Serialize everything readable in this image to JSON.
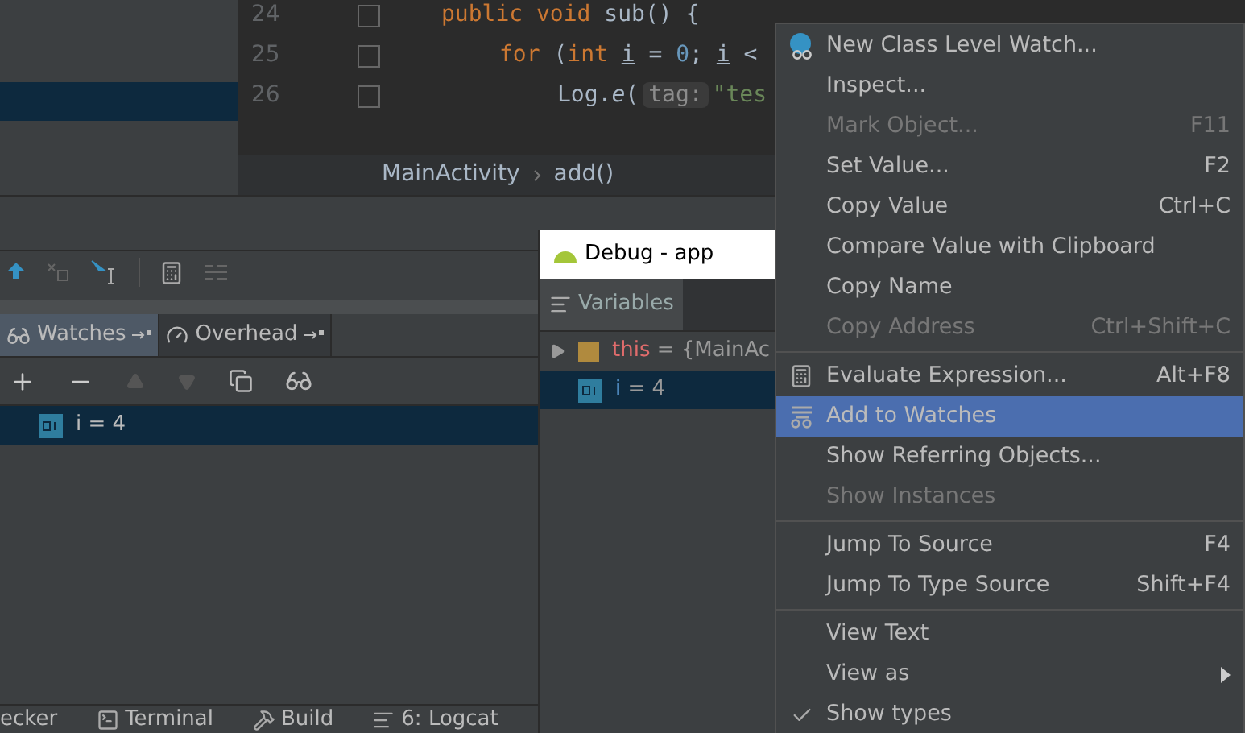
{
  "editor": {
    "lines": [
      {
        "number": "24",
        "tokens": [
          {
            "kind": "keyword",
            "text": "public void "
          },
          {
            "kind": "plain",
            "text": "sub() {"
          }
        ]
      },
      {
        "number": "25",
        "tokens": [
          {
            "kind": "keyword",
            "text": "for "
          },
          {
            "kind": "plain",
            "text": "("
          },
          {
            "kind": "keyword",
            "text": "int "
          },
          {
            "kind": "var",
            "text": "i"
          },
          {
            "kind": "plain",
            "text": " = "
          },
          {
            "kind": "number",
            "text": "0"
          },
          {
            "kind": "plain",
            "text": "; "
          },
          {
            "kind": "var",
            "text": "i"
          },
          {
            "kind": "plain",
            "text": " <"
          }
        ]
      },
      {
        "number": "26",
        "tokens": [
          {
            "kind": "plain",
            "text": "Log."
          },
          {
            "kind": "italic",
            "text": "e"
          },
          {
            "kind": "plain",
            "text": "("
          },
          {
            "kind": "hint",
            "text": "tag:"
          },
          {
            "kind": "string",
            "text": "\"tes"
          }
        ]
      }
    ],
    "breadcrumb": [
      "MainActivity",
      "add()"
    ]
  },
  "debug_tabs": [
    {
      "label": "Watches",
      "selected": true
    },
    {
      "label": "Overhead",
      "selected": false
    }
  ],
  "watches": [
    {
      "text": "i = 4",
      "selected": true
    }
  ],
  "bottom_tabs": [
    {
      "label": "ecker",
      "kind": "plain"
    },
    {
      "label": "Terminal",
      "kind": "terminal"
    },
    {
      "label": "Build",
      "kind": "build"
    },
    {
      "label": "6: Logcat",
      "kind": "logcat"
    }
  ],
  "floating_window": {
    "title": "Debug - app",
    "tab": "Variables",
    "variables": [
      {
        "name": "this",
        "value": " = {MainAc",
        "kind": "object",
        "selected": false
      },
      {
        "name": "i",
        "value": " = 4",
        "kind": "primitive",
        "selected": true
      }
    ]
  },
  "context_menu": [
    {
      "kind": "item",
      "label": "New Class Level Watch...",
      "disabled": false,
      "selected": false
    },
    {
      "kind": "item",
      "label": "Inspect...",
      "disabled": false,
      "selected": false
    },
    {
      "kind": "item",
      "label": "Mark Object...",
      "shortcut": "F11",
      "disabled": true,
      "selected": false
    },
    {
      "kind": "item",
      "label": "Set Value...",
      "shortcut": "F2",
      "disabled": false,
      "selected": false
    },
    {
      "kind": "item",
      "label": "Copy Value",
      "shortcut": "Ctrl+C",
      "disabled": false,
      "selected": false
    },
    {
      "kind": "item",
      "label": "Compare Value with Clipboard",
      "disabled": false,
      "selected": false
    },
    {
      "kind": "item",
      "label": "Copy Name",
      "disabled": false,
      "selected": false
    },
    {
      "kind": "item",
      "label": "Copy Address",
      "shortcut": "Ctrl+Shift+C",
      "disabled": true,
      "selected": false
    },
    {
      "kind": "separator"
    },
    {
      "kind": "item",
      "label": "Evaluate Expression...",
      "shortcut": "Alt+F8",
      "disabled": false,
      "selected": false
    },
    {
      "kind": "item",
      "label": "Add to Watches",
      "disabled": false,
      "selected": true
    },
    {
      "kind": "item",
      "label": "Show Referring Objects...",
      "disabled": false,
      "selected": false
    },
    {
      "kind": "item",
      "label": "Show Instances",
      "disabled": true,
      "selected": false
    },
    {
      "kind": "separator"
    },
    {
      "kind": "item",
      "label": "Jump To Source",
      "shortcut": "F4",
      "disabled": false,
      "selected": false
    },
    {
      "kind": "item",
      "label": "Jump To Type Source",
      "shortcut": "Shift+F4",
      "disabled": false,
      "selected": false
    },
    {
      "kind": "separator"
    },
    {
      "kind": "item",
      "label": "View Text",
      "disabled": false,
      "selected": false
    },
    {
      "kind": "item",
      "label": "View as",
      "submenu": true,
      "disabled": false,
      "selected": false
    },
    {
      "kind": "item",
      "label": "Show types",
      "checked": true,
      "disabled": false,
      "selected": false
    }
  ]
}
